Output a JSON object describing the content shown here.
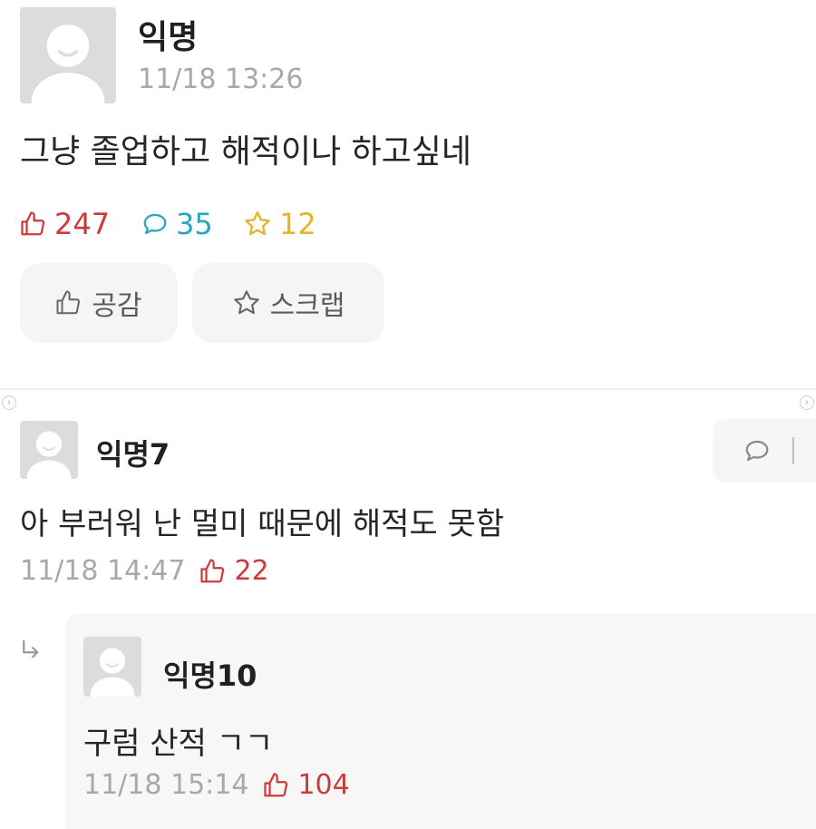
{
  "post": {
    "author": "익명",
    "time": "11/18 13:26",
    "body": "그냥 졸업하고 해적이나 하고싶네",
    "stats": {
      "likes": "247",
      "comments": "35",
      "scraps": "12"
    },
    "actions": {
      "like_label": "공감",
      "scrap_label": "스크랩"
    }
  },
  "comment": {
    "author": "익명7",
    "body": "아 부러워 난 멀미 때문에 해적도 못함",
    "time": "11/18 14:47",
    "likes": "22"
  },
  "reply": {
    "author": "익명10",
    "body": "구럼 산적 ㄱㄱ",
    "time": "11/18 15:14",
    "likes": "104"
  },
  "colors": {
    "like": "#cc3b3b",
    "comment": "#27a7bf",
    "scrap": "#e3b52f",
    "meta_text": "#a8a8a8"
  },
  "icons": [
    "avatar-placeholder-icon",
    "thumbs-up-icon",
    "speech-bubble-icon",
    "star-icon",
    "reply-arrow-icon",
    "more-vertical-icon"
  ]
}
